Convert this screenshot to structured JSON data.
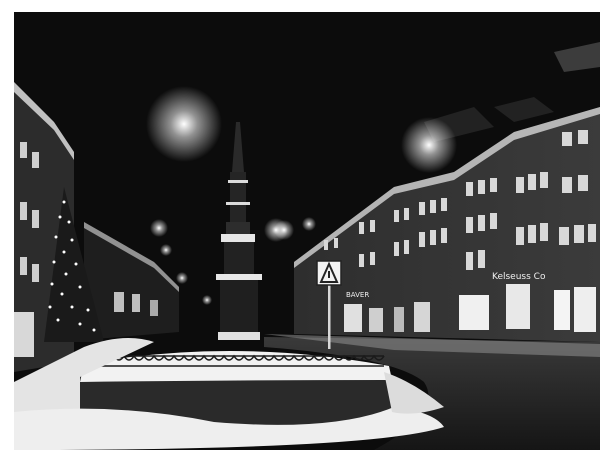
{
  "photo": {
    "subject": "",
    "visible_text": {
      "shop_sign_left": "BAVER",
      "shop_sign_right": "Kelseuss Co"
    },
    "colors": {
      "border": "#ffffff",
      "sky": "#0c0c0c",
      "light": "#ffffff",
      "snow": "#e8e8e8"
    }
  }
}
